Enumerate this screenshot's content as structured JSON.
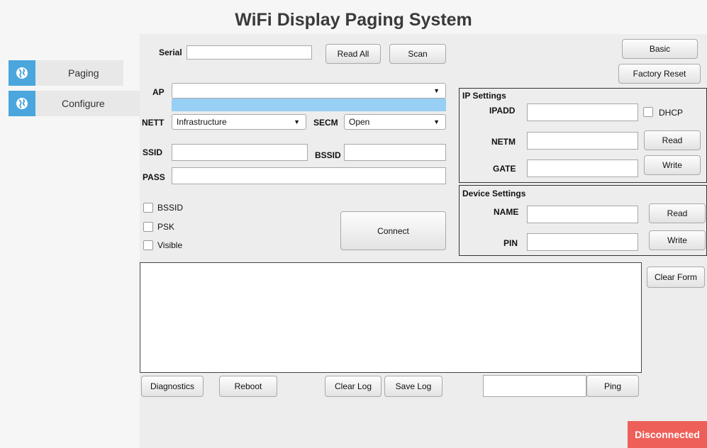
{
  "app": {
    "title": "WiFi Display Paging System"
  },
  "sidebar": {
    "items": [
      {
        "label": "Paging",
        "icon": "globe-icon"
      },
      {
        "label": "Configure",
        "icon": "globe-icon"
      }
    ]
  },
  "serial": {
    "label": "Serial",
    "value": "",
    "read_all": "Read All",
    "scan": "Scan"
  },
  "top_buttons": {
    "basic": "Basic",
    "factory_reset": "Factory Reset"
  },
  "wifi": {
    "ap_label": "AP",
    "ap_value": "",
    "nett_label": "NETT",
    "nett_value": "Infrastructure",
    "secm_label": "SECM",
    "secm_value": "Open",
    "ssid_label": "SSID",
    "ssid_value": "",
    "bssid_label": "BSSID",
    "bssid_value": "",
    "pass_label": "PASS",
    "pass_value": "",
    "options": [
      {
        "label": "BSSID",
        "checked": false
      },
      {
        "label": "PSK",
        "checked": false
      },
      {
        "label": "Visible",
        "checked": false
      }
    ],
    "connect": "Connect"
  },
  "ip_settings": {
    "title": "IP Settings",
    "ipadd_label": "IPADD",
    "netm_label": "NETM",
    "gate_label": "GATE",
    "dhcp_label": "DHCP",
    "dhcp_checked": false,
    "read": "Read",
    "write": "Write"
  },
  "device_settings": {
    "title": "Device Settings",
    "name_label": "NAME",
    "pin_label": "PIN",
    "read": "Read",
    "write": "Write"
  },
  "log": {
    "content": "",
    "clear_form": "Clear Form"
  },
  "bottom": {
    "diagnostics": "Diagnostics",
    "reboot": "Reboot",
    "clear_log": "Clear Log",
    "save_log": "Save Log",
    "ping_value": "",
    "ping": "Ping"
  },
  "status": {
    "text": "Disconnected",
    "color": "#ee5f5a"
  },
  "colors": {
    "accent": "#4aa6dc",
    "highlight": "#97cff5"
  }
}
